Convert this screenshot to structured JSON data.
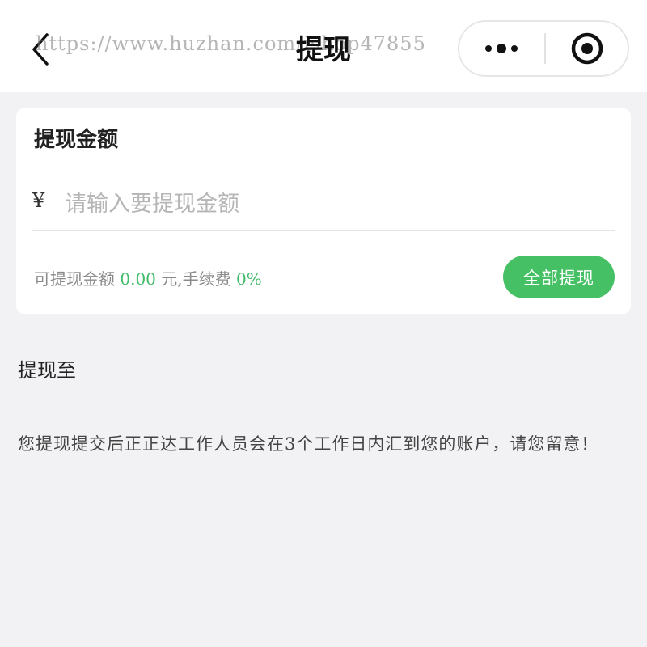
{
  "navbar": {
    "title": "提现",
    "watermark": "https://www.huzhan.com/ishop47855"
  },
  "card": {
    "title": "提现金额",
    "currency_symbol": "¥",
    "amount_placeholder": "请输入要提现金额",
    "available_prefix": "可提现金额 ",
    "available_amount": "0.00",
    "available_unit": " 元,手续费 ",
    "fee_rate": "0%",
    "all_button_label": "全部提现"
  },
  "withdraw_to": {
    "label": "提现至"
  },
  "notice": "您提现提交后正正达工作人员会在3个工作日内汇到您的账户，请您留意！",
  "colors": {
    "accent_green": "#45c065",
    "background": "#f2f2f4"
  }
}
